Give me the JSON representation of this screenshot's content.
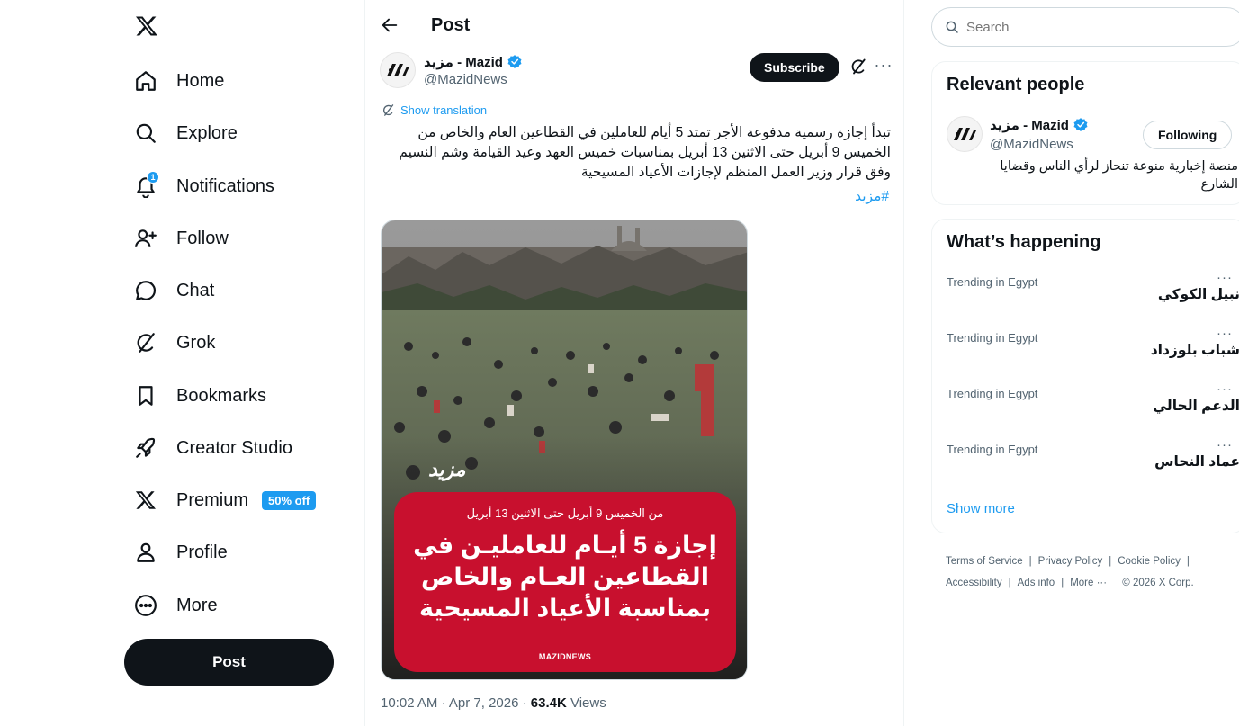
{
  "nav": {
    "items": [
      {
        "label": "Home",
        "icon": "home-icon"
      },
      {
        "label": "Explore",
        "icon": "search-icon"
      },
      {
        "label": "Notifications",
        "icon": "bell-icon",
        "badge": "1"
      },
      {
        "label": "Follow",
        "icon": "add-person-icon"
      },
      {
        "label": "Chat",
        "icon": "chat-bubble-icon"
      },
      {
        "label": "Grok",
        "icon": "grok-icon"
      },
      {
        "label": "Bookmarks",
        "icon": "bookmark-icon"
      },
      {
        "label": "Creator Studio",
        "icon": "rocket-icon"
      },
      {
        "label": "Premium",
        "icon": "x-logo-icon",
        "promo": "50% off"
      },
      {
        "label": "Profile",
        "icon": "person-icon"
      },
      {
        "label": "More",
        "icon": "more-circle-icon"
      }
    ],
    "post_label": "Post"
  },
  "main": {
    "title": "Post",
    "author": {
      "name": "مزيد - Mazid",
      "handle": "@MazidNews"
    },
    "subscribe_label": "Subscribe",
    "show_translation": "Show translation",
    "text": "تبدأ إجازة رسمية مدفوعة الأجر تمتد 5 أيام للعاملين في القطاعين العام والخاص من الخميس 9 أبريل حتى الاثنين 13 أبريل بمناسبات خميس العهد وعيد القيامة وشم النسيم وفق قرار وزير العمل المنظم لإجازات الأعياد المسيحية",
    "hashtag": "#مزيد",
    "media": {
      "date_line": "من الخميس 9 أبريل حتى الاثنين 13 أبريل",
      "headline": "إجازة 5 أيـام للعامليـن في القطاعين العـام والخاص بمناسبة الأعياد المسيحية",
      "footer": "MAZIDNEWS",
      "accent": "#c8102e"
    },
    "meta": {
      "time": "10:02 AM · Apr 7, 2026 · ",
      "views": "63.4K",
      "views_label": " Views"
    }
  },
  "right": {
    "search_placeholder": "Search",
    "relevant": {
      "title": "Relevant people",
      "name": "مزيد - Mazid",
      "handle": "@MazidNews",
      "follow_label": "Following",
      "bio": "منصة إخبارية منوعة تنحاز لرأي الناس وقضايا الشارع"
    },
    "happening": {
      "title": "What’s happening",
      "trends": [
        {
          "context": "Trending in Egypt",
          "name": "نبيل الكوكي"
        },
        {
          "context": "Trending in Egypt",
          "name": "شباب بلوزداد"
        },
        {
          "context": "Trending in Egypt",
          "name": "الدعم الحالي"
        },
        {
          "context": "Trending in Egypt",
          "name": "عماد النحاس"
        }
      ],
      "show_more": "Show more"
    },
    "footer": {
      "terms": "Terms of Service",
      "privacy": "Privacy Policy",
      "cookie": "Cookie Policy",
      "accessibility": "Accessibility",
      "ads": "Ads info",
      "more": "More ···",
      "copyright": "© 2026 X Corp."
    }
  },
  "colors": {
    "accent": "#1d9bf0",
    "text": "#0f1419",
    "muted": "#536471",
    "border": "#cfd9de"
  }
}
